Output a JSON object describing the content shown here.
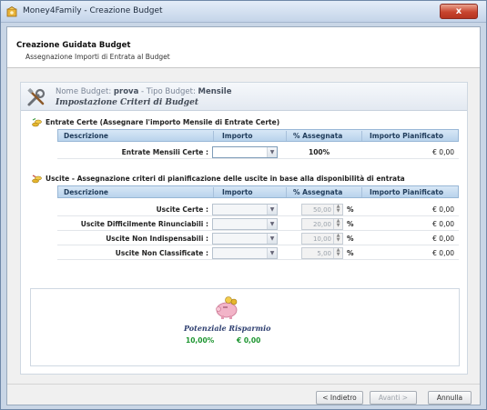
{
  "window": {
    "title": "Money4Family - Creazione Budget",
    "close_label": "x"
  },
  "header": {
    "title": "Creazione Guidata Budget",
    "subtitle": "Assegnazione Importi di Entrata al Budget"
  },
  "budget": {
    "name_label": "Nome Budget:",
    "name_value": "prova",
    "type_label": "- Tipo Budget:",
    "type_value": "Mensile",
    "step_title": "Impostazione Criteri di Budget"
  },
  "entrate": {
    "section_title": "Entrate Certe (Assegnare l'importo Mensile di Entrate Certe)",
    "columns": [
      "Descrizione",
      "Importo",
      "% Assegnata",
      "Importo Pianificato"
    ],
    "row": {
      "label": "Entrate Mensili Certe :",
      "importo": "",
      "percent": "100%",
      "pianificato": "€ 0,00"
    }
  },
  "uscite": {
    "section_title": "Uscite - Assegnazione criteri di pianificazione delle uscite in base alla disponibilità di entrata",
    "columns": [
      "Descrizione",
      "Importo",
      "% Assegnata",
      "Importo Pianificato"
    ],
    "rows": [
      {
        "label": "Uscite Certe :",
        "importo": "",
        "percent": "50,00",
        "pct_sign": "%",
        "pianificato": "€ 0,00"
      },
      {
        "label": "Uscite Difficilmente Rinunciabili :",
        "importo": "",
        "percent": "20,00",
        "pct_sign": "%",
        "pianificato": "€ 0,00"
      },
      {
        "label": "Uscite Non Indispensabili :",
        "importo": "",
        "percent": "10,00",
        "pct_sign": "%",
        "pianificato": "€ 0,00"
      },
      {
        "label": "Uscite Non Classificate :",
        "importo": "",
        "percent": "5,00",
        "pct_sign": "%",
        "pianificato": "€ 0,00"
      }
    ]
  },
  "savings": {
    "title": "Potenziale Risparmio",
    "percent": "10,00%",
    "amount": "€ 0,00"
  },
  "footer": {
    "back_label": "< Indietro",
    "next_label": "Avanti >",
    "cancel_label": "Annulla"
  },
  "colors": {
    "header_gradient_top": "#d7e7f6",
    "savings_green": "#1d9530",
    "close_red": "#c8442e"
  }
}
